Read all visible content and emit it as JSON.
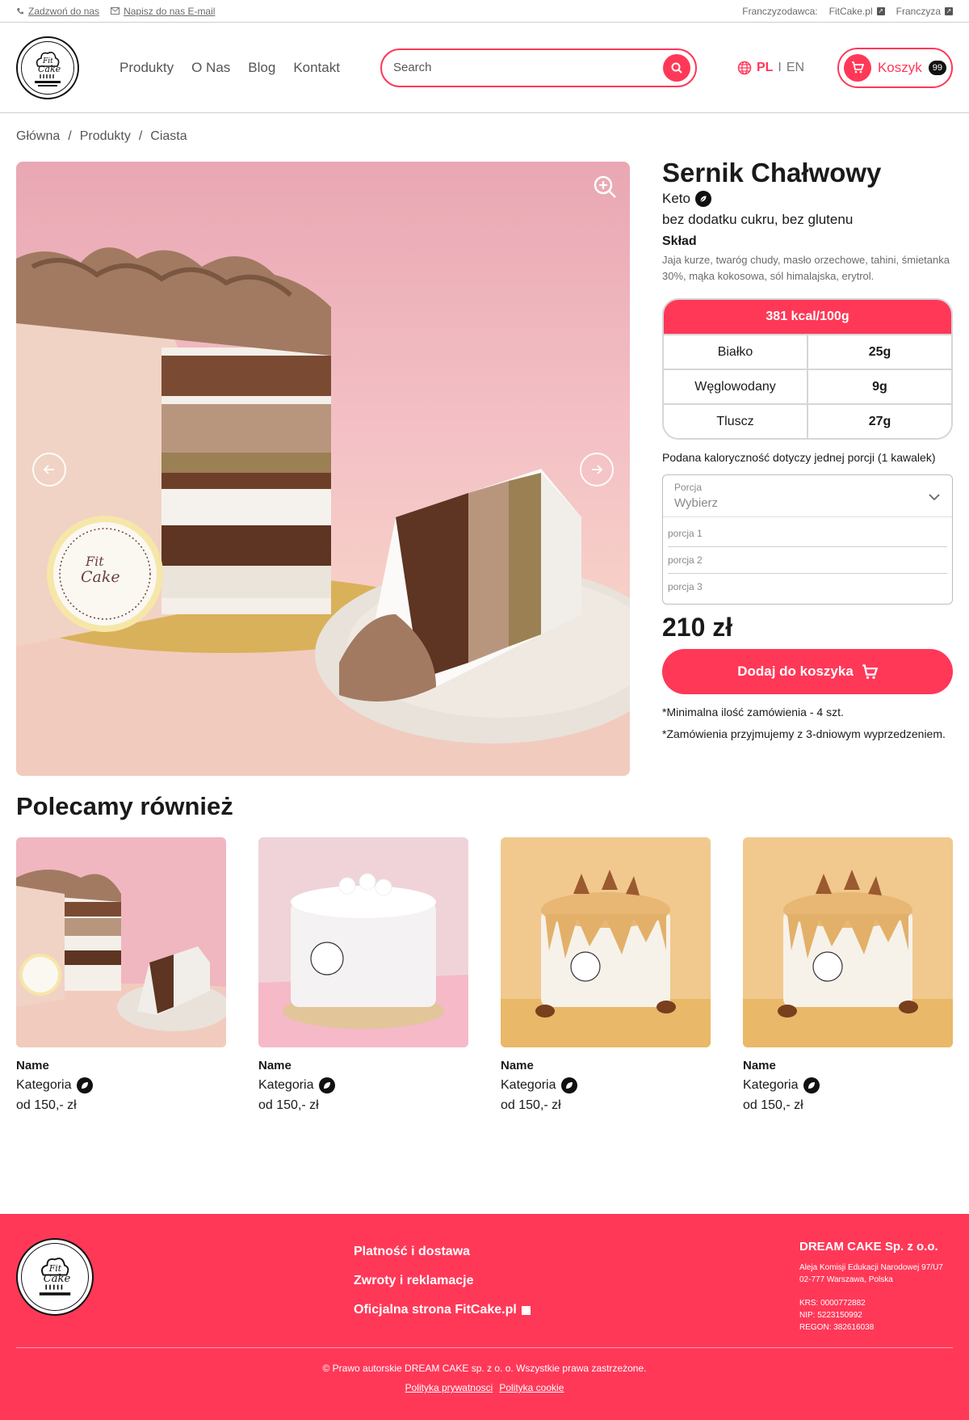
{
  "topbar": {
    "call": "Zadzwoń do nas",
    "email": "Napisz do nas E-mail",
    "franchisor_label": "Franczyzodawca:",
    "franchisor_link": "FitCake.pl",
    "franchise": "Franczyza"
  },
  "header": {
    "logo_alt": "Fit Cake",
    "nav": [
      "Produkty",
      "O Nas",
      "Blog",
      "Kontakt"
    ],
    "search_placeholder": "Search",
    "lang_pl": "PL",
    "lang_sep": "I",
    "lang_en": "EN",
    "cart_label": "Koszyk",
    "cart_count": "99"
  },
  "breadcrumb": [
    "Główna",
    "/",
    "Produkty",
    "/",
    "Ciasta"
  ],
  "product": {
    "title": "Sernik Chałwowy",
    "diet": "Keto",
    "tags": "bez dodatku cukru, bez glutenu",
    "ingredients_heading": "Skład",
    "ingredients": "Jaja kurze, twaróg chudy, masło orzechowe, tahini, śmietanka 30%, mąka kokosowa, sól himalajska, erytrol.",
    "nutrition": {
      "header": "381 kcal/100g",
      "rows": [
        {
          "label": "Białko",
          "value": "25g"
        },
        {
          "label": "Węglowodany",
          "value": "9g"
        },
        {
          "label": "Tluscz",
          "value": "27g"
        }
      ]
    },
    "kcal_note": "Podana kaloryczność dotyczy jednej porcji (1 kawalek)",
    "portion": {
      "label": "Porcja",
      "value": "Wybierz",
      "options": [
        "porcja 1",
        "porcja 2",
        "porcja 3"
      ]
    },
    "price": "210 zł",
    "add_button": "Dodaj do koszyka",
    "note_min": "*Minimalna ilość zamówienia - 4 szt.",
    "note_order": "*Zamówienia przyjmujemy z 3-dniowym wyprzedzeniem."
  },
  "recommended": {
    "title": "Polecamy również",
    "cards": [
      {
        "name": "Name",
        "category": "Kategoria",
        "price": "od 150,-  zł"
      },
      {
        "name": "Name",
        "category": "Kategoria",
        "price": "od 150,-  zł"
      },
      {
        "name": "Name",
        "category": "Kategoria",
        "price": "od 150,-  zł"
      },
      {
        "name": "Name",
        "category": "Kategoria",
        "price": "od 150,-  zł"
      }
    ]
  },
  "footer": {
    "links": [
      "Platność i dostawa",
      "Zwroty i reklamacje",
      "Oficjalna strona FitCake.pl"
    ],
    "company_name": "DREAM CAKE Sp. z o.o.",
    "address1": "Aleja Komisji Edukacji Narodowej 97/U7",
    "address2": "02-777 Warszawa, Polska",
    "krs": "KRS: 0000772882",
    "nip": "NIP: 5223150992",
    "regon": "REGON: 382616038",
    "copyright": "© Prawo autorskie DREAM CAKE sp. z o. o. Wszystkie prawa zastrzeżone.",
    "privacy": "Polityka prywatnosci",
    "cookies": "Polityka cookie"
  },
  "colors": {
    "accent": "#ff3858",
    "text": "#1a1a1a",
    "muted": "#6b6b6b"
  },
  "icons": [
    "phone-icon",
    "mail-icon",
    "external-link-icon",
    "search-icon",
    "globe-icon",
    "cart-icon",
    "zoom-in-icon",
    "arrow-left-icon",
    "arrow-right-icon",
    "leaf-icon",
    "chevron-down-icon"
  ]
}
